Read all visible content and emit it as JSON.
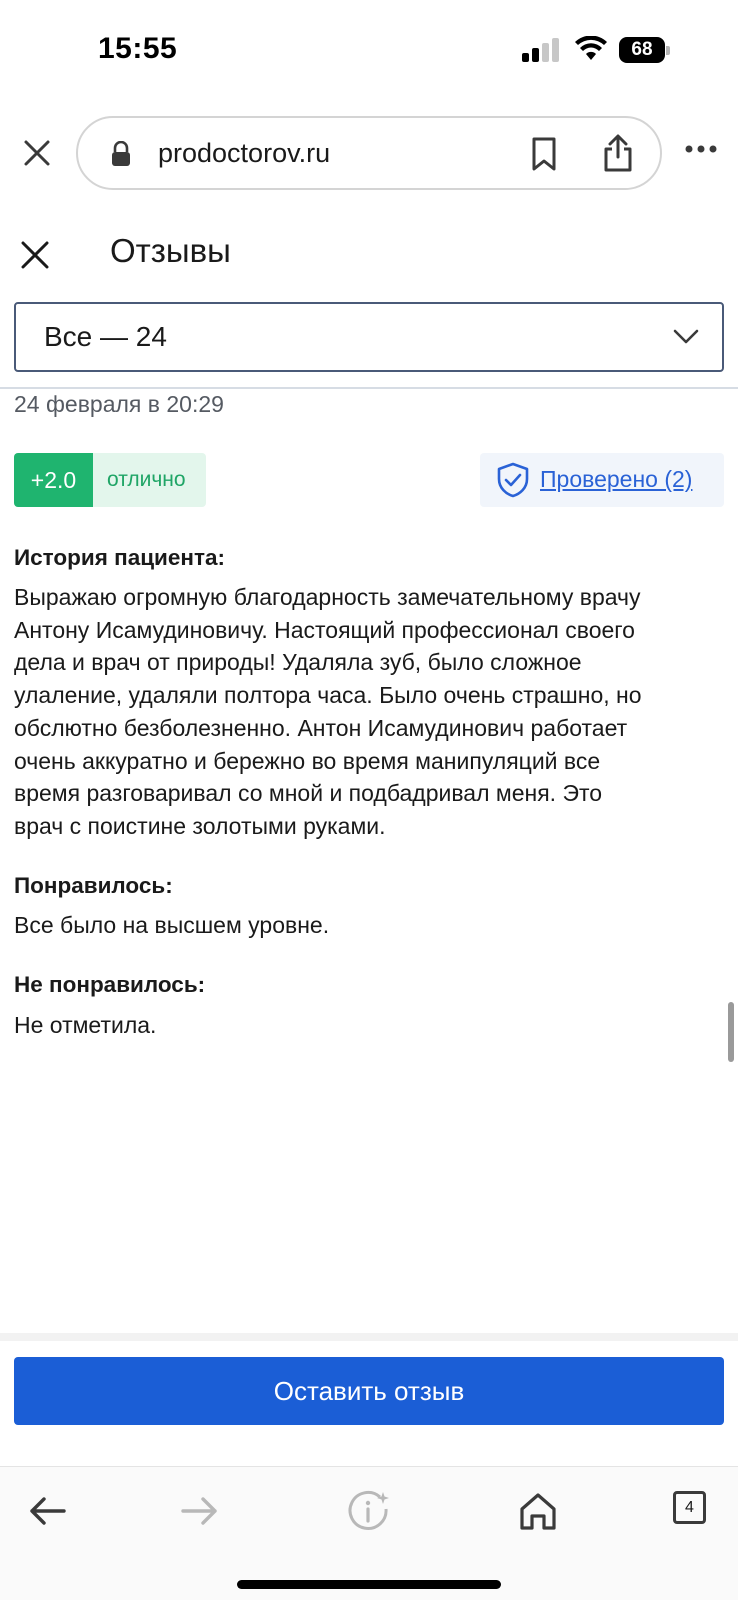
{
  "status_bar": {
    "time": "15:55",
    "battery_level": "68"
  },
  "browser": {
    "url": "prodoctorov.ru",
    "icons": [
      "close-icon",
      "lock-icon",
      "bookmark-icon",
      "share-icon",
      "more-icon"
    ]
  },
  "panel": {
    "title": "Отзывы",
    "filter_value": "Все — 24"
  },
  "review": {
    "date": "24 февраля в 20:29",
    "rating_score": "+2.0",
    "rating_word": "отлично",
    "verified_label": "Проверено (2)",
    "history_label": "История пациента:",
    "history_lines": [
      "Выражаю огромную благодарность замечательному врачу",
      "Антону Исамудиновичу. Настоящий профессионал своего",
      "дела и врач от природы! Удаляла зуб, было сложное",
      "улаление, удаляли полтора часа. Было очень страшно, но",
      "обслютно безболезненно. Антон Исамудинович работает",
      "очень аккуратно и бережно во время манипуляций все",
      "время разговаривал со мной и подбадривал меня. Это",
      "врач с поистине золотыми руками."
    ],
    "liked_label": "Понравилось:",
    "liked_text": "Все было на высшем уровне.",
    "disliked_label": "Не понравилось:",
    "disliked_text": "Не отметила."
  },
  "actions": {
    "leave_review_label": "Оставить отзыв"
  },
  "toolbar": {
    "tabs_count": "4",
    "icons": [
      "back-arrow-icon",
      "forward-arrow-icon",
      "info-sparkle-icon",
      "home-icon",
      "tabs-icon"
    ]
  },
  "colors": {
    "primary_button": "#1b5ed6",
    "rating_green": "#1fb46f",
    "link_blue": "#2a62d6"
  }
}
